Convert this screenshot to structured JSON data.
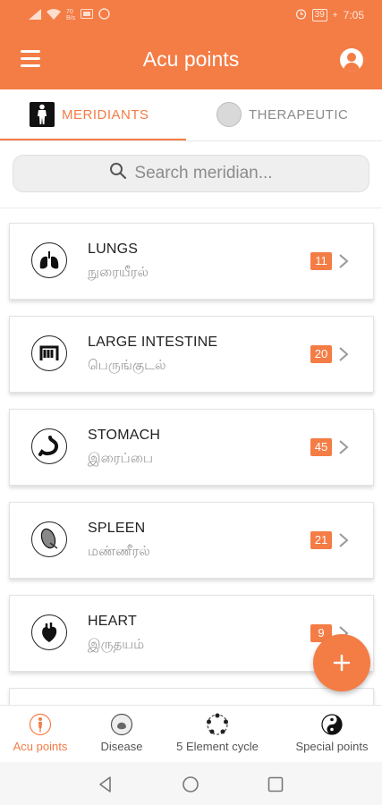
{
  "status_bar": {
    "net_top": "70",
    "net_bottom": "B/s",
    "battery": "39",
    "time": "7:05"
  },
  "app_bar": {
    "title": "Acu points",
    "menu_icon": "hamburger-menu-icon",
    "profile_icon": "account-circle-icon"
  },
  "tabs": [
    {
      "label": "MERIDIANTS",
      "icon": "body-figure-icon",
      "selected": true
    },
    {
      "label": "THERAPEUTIC",
      "icon": "therapy-image-icon",
      "selected": false
    }
  ],
  "search": {
    "placeholder": "Search meridian..."
  },
  "meridians": [
    {
      "name": "LUNGS",
      "tamil": "நுரையீரல்",
      "count": "11",
      "icon": "lungs-icon"
    },
    {
      "name": "LARGE INTESTINE",
      "tamil": "பெருங்குடல்",
      "count": "20",
      "icon": "intestine-icon"
    },
    {
      "name": "STOMACH",
      "tamil": "இரைப்பை",
      "count": "45",
      "icon": "stomach-icon"
    },
    {
      "name": "SPLEEN",
      "tamil": "மண்ணீரல்",
      "count": "21",
      "icon": "spleen-icon"
    },
    {
      "name": "HEART",
      "tamil": "இருதயம்",
      "count": "9",
      "icon": "heart-icon"
    }
  ],
  "fab": {
    "icon": "plus-icon"
  },
  "bottom_nav": [
    {
      "label": "Acu points",
      "icon": "acupoint-figure-icon",
      "active": true
    },
    {
      "label": "Disease",
      "icon": "disease-icon",
      "active": false
    },
    {
      "label": "5 Element cycle",
      "icon": "element-cycle-icon",
      "active": false
    },
    {
      "label": "Special points",
      "icon": "yin-yang-icon",
      "active": false
    }
  ],
  "colors": {
    "primary": "#f47c45",
    "text_dark": "#222222",
    "text_muted": "#9a9a9a"
  }
}
